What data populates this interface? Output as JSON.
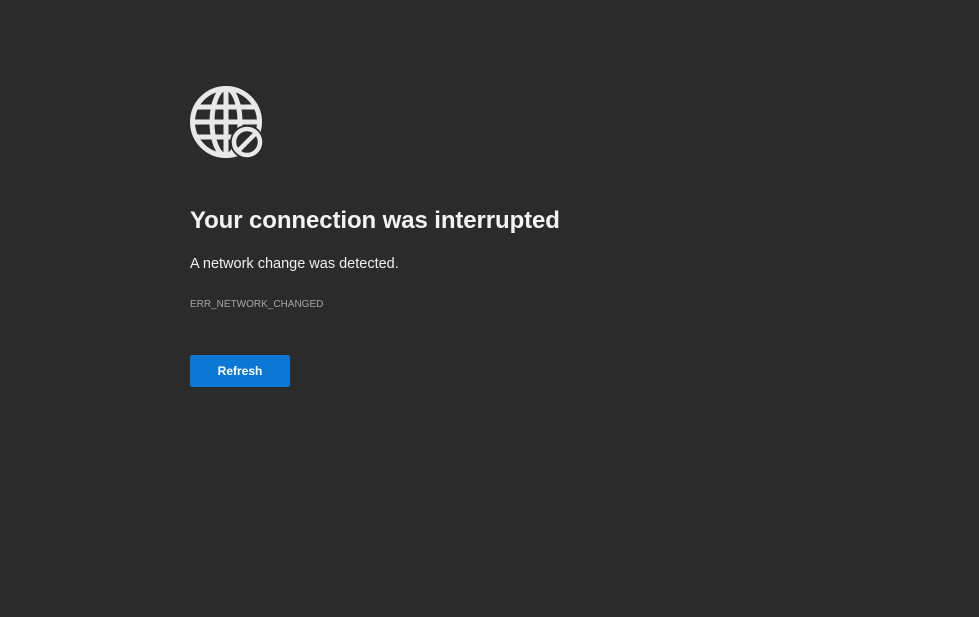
{
  "error": {
    "icon": "globe-blocked-icon",
    "title": "Your connection was interrupted",
    "message": "A network change was detected.",
    "code": "ERR_NETWORK_CHANGED"
  },
  "actions": {
    "refresh_label": "Refresh"
  },
  "colors": {
    "background": "#2b2b2b",
    "accent": "#0a78d4",
    "text": "#f3f3f3",
    "muted": "#a6a6a6"
  }
}
